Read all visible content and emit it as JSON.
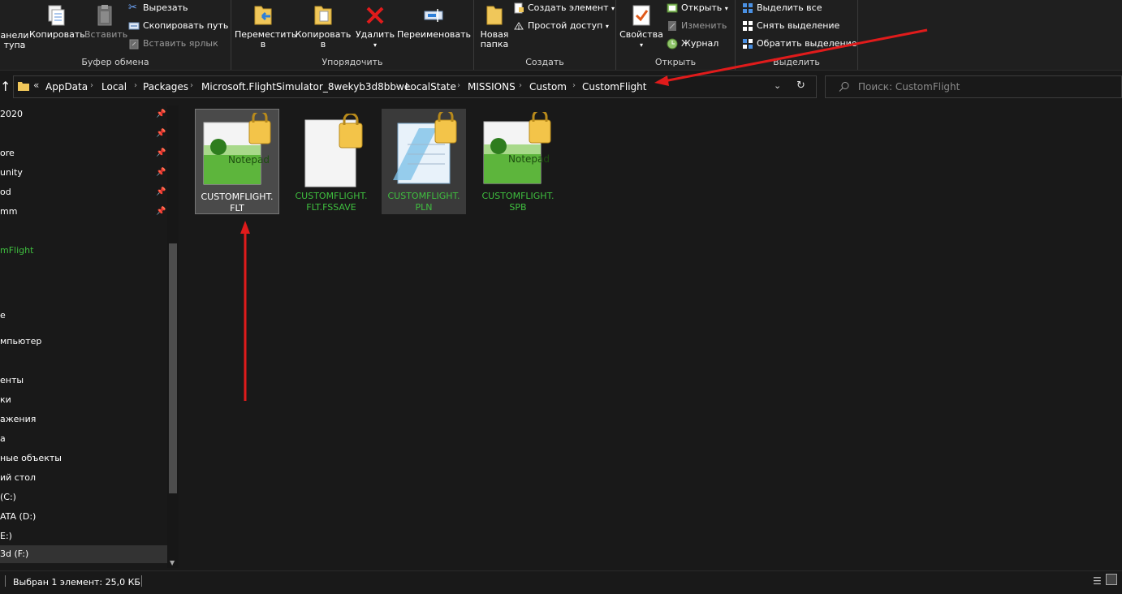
{
  "ribbon": {
    "clipboard": {
      "title": "Буфер обмена",
      "pin_label_1": "анели",
      "pin_label_2": "тупа",
      "copy": "Копировать",
      "paste": "Вставить",
      "cut": "Вырезать",
      "copy_path": "Скопировать путь",
      "paste_shortcut": "Вставить ярлык"
    },
    "organize": {
      "title": "Упорядочить",
      "move_to_1": "Переместить",
      "move_to_2": "в",
      "copy_to_1": "Копировать",
      "copy_to_2": "в",
      "delete": "Удалить",
      "rename": "Переименовать"
    },
    "create": {
      "title": "Создать",
      "new_folder_1": "Новая",
      "new_folder_2": "папка",
      "new_item": "Создать элемент",
      "easy_access": "Простой доступ"
    },
    "open": {
      "title": "Открыть",
      "properties": "Свойства",
      "open": "Открыть",
      "edit": "Изменить",
      "history": "Журнал"
    },
    "select": {
      "title": "Выделить",
      "select_all": "Выделить все",
      "select_none": "Снять выделение",
      "invert": "Обратить выделение"
    }
  },
  "address": {
    "overflow": "«",
    "crumbs": [
      "AppData",
      "Local",
      "Packages",
      "Microsoft.FlightSimulator_8wekyb3d8bbwe",
      "LocalState",
      "MISSIONS",
      "Custom",
      "CustomFlight"
    ],
    "search_placeholder": "Поиск: CustomFlight"
  },
  "nav": {
    "items": [
      "2020",
      "ore",
      "unity",
      "od",
      "mm",
      "mFlight",
      "e",
      "мпьютер",
      "енты",
      "ки",
      "ажения",
      "а",
      "ные объекты",
      "ий стол",
      "(C:)",
      "ATA (D:)",
      "E:)",
      "3d (F:)"
    ]
  },
  "files": [
    {
      "name": "CUSTOMFLIGHT.\nFLT",
      "color": "#ffffff"
    },
    {
      "name": "CUSTOMFLIGHT.\nFLT.FSSAVE",
      "color": "#3fbf3f"
    },
    {
      "name": "CUSTOMFLIGHT.\nPLN",
      "color": "#3fbf3f"
    },
    {
      "name": "CUSTOMFLIGHT.\nSPB",
      "color": "#3fbf3f"
    }
  ],
  "status": {
    "text": "Выбран 1 элемент: 25,0 КБ"
  },
  "colors": {
    "accent_arrow": "#e01b1b",
    "compressed_green": "#3fbf3f"
  }
}
